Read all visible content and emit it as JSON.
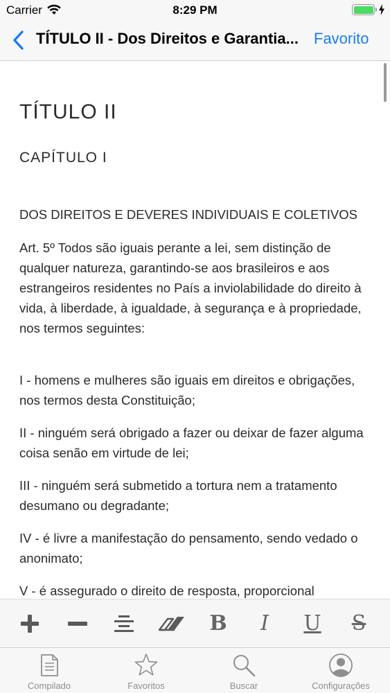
{
  "status_bar": {
    "carrier": "Carrier",
    "time": "8:29 PM",
    "battery_color": "#4cd964"
  },
  "nav": {
    "back_icon": "chevron-left-icon",
    "title": "TÍTULO II - Dos Direitos e Garantia...",
    "favorite_label": "Favorito",
    "accent_color": "#1a7cf5"
  },
  "document": {
    "heading": "TÍTULO II",
    "subheading": "CAPÍTULO I",
    "paragraphs": [
      "DOS DIREITOS E DEVERES INDIVIDUAIS E COLETIVOS",
      "Art. 5º Todos são iguais perante a lei, sem distinção de qualquer natureza, garantindo-se aos brasileiros e aos estrangeiros residentes no País a inviolabilidade do direito à vida, à liberdade, à igualdade, à segurança e à propriedade, nos termos seguintes:",
      "I - homens e mulheres são iguais em direitos e obrigações, nos termos desta Constituição;",
      "II - ninguém será obrigado a fazer ou deixar de fazer alguma coisa senão em virtude de lei;",
      "III - ninguém será submetido a tortura nem a tratamento desumano ou degradante;",
      "IV - é livre a manifestação do pensamento, sendo vedado o anonimato;",
      "V - é assegurado o direito de resposta, proporcional"
    ]
  },
  "format_toolbar": {
    "tools": [
      {
        "name": "increase-font-icon"
      },
      {
        "name": "decrease-font-icon"
      },
      {
        "name": "align-center-icon"
      },
      {
        "name": "eraser-icon"
      },
      {
        "name": "bold-icon",
        "glyph": "B"
      },
      {
        "name": "italic-icon",
        "glyph": "I"
      },
      {
        "name": "underline-icon",
        "glyph": "U"
      },
      {
        "name": "strikethrough-icon",
        "glyph": "S"
      }
    ]
  },
  "tab_bar": {
    "tabs": [
      {
        "label": "Compilado",
        "icon": "document-icon"
      },
      {
        "label": "Favoritos",
        "icon": "star-icon"
      },
      {
        "label": "Buscar",
        "icon": "search-icon"
      },
      {
        "label": "Configurações",
        "icon": "user-icon"
      }
    ]
  }
}
